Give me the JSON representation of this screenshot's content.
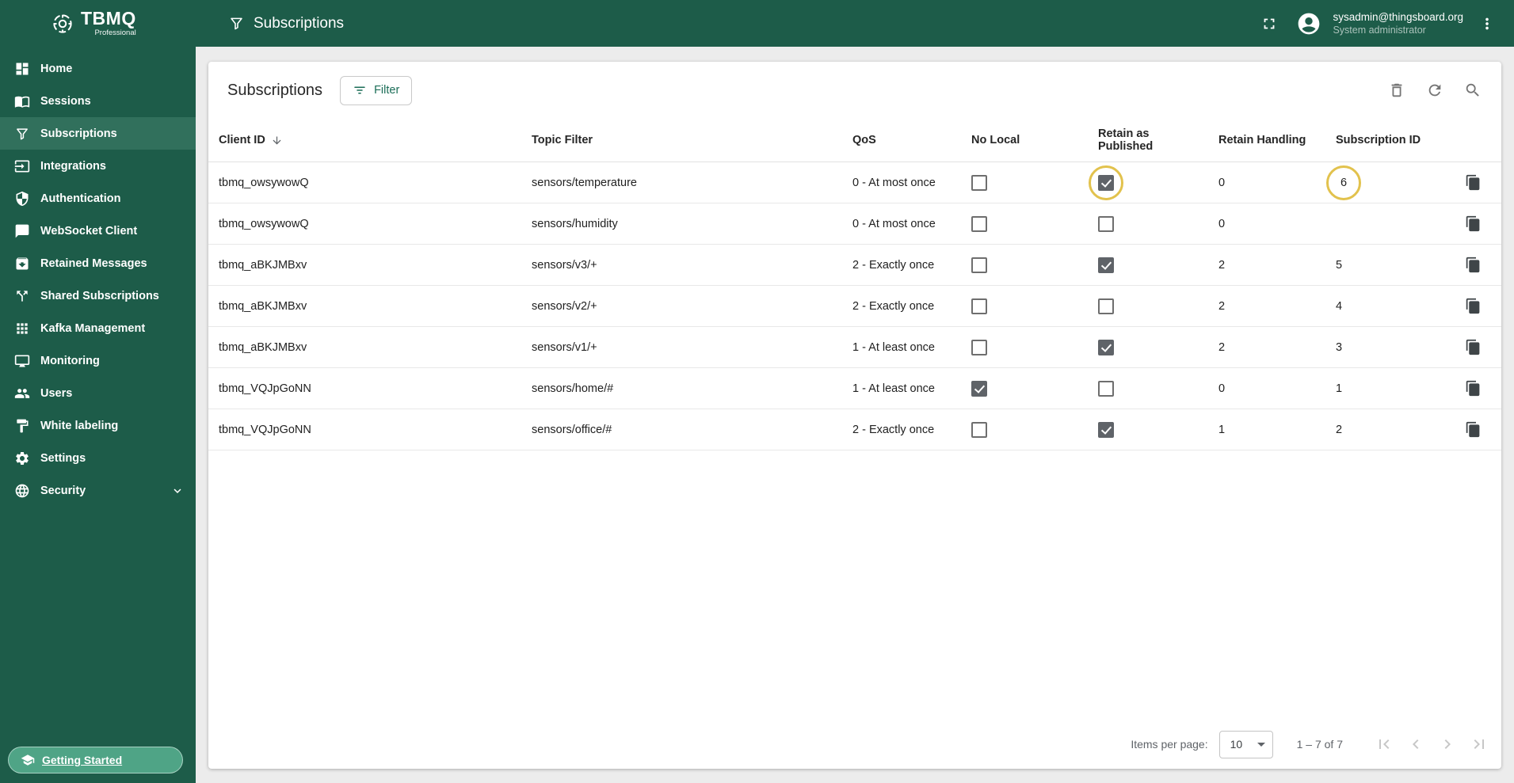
{
  "topbar": {
    "logo_title": "TBMQ",
    "logo_subtitle": "Professional",
    "page_title": "Subscriptions",
    "user": {
      "email": "sysadmin@thingsboard.org",
      "role": "System administrator"
    }
  },
  "sidebar": {
    "items": [
      {
        "label": "Home",
        "icon": "home-icon",
        "active": false
      },
      {
        "label": "Sessions",
        "icon": "sessions-icon",
        "active": false
      },
      {
        "label": "Subscriptions",
        "icon": "subscriptions-funnel-icon",
        "active": true
      },
      {
        "label": "Integrations",
        "icon": "integrations-icon",
        "active": false
      },
      {
        "label": "Authentication",
        "icon": "authentication-shield-icon",
        "active": false
      },
      {
        "label": "WebSocket Client",
        "icon": "websocket-chat-icon",
        "active": false
      },
      {
        "label": "Retained Messages",
        "icon": "retained-messages-archive-icon",
        "active": false
      },
      {
        "label": "Shared Subscriptions",
        "icon": "shared-subscriptions-split-icon",
        "active": false
      },
      {
        "label": "Kafka Management",
        "icon": "kafka-apps-icon",
        "active": false
      },
      {
        "label": "Monitoring",
        "icon": "monitoring-icon",
        "active": false
      },
      {
        "label": "Users",
        "icon": "users-icon",
        "active": false
      },
      {
        "label": "White labeling",
        "icon": "white-labeling-paint-icon",
        "active": false
      },
      {
        "label": "Settings",
        "icon": "settings-gear-icon",
        "active": false
      },
      {
        "label": "Security",
        "icon": "security-globe-icon",
        "active": false,
        "expandable": true
      }
    ],
    "getting_started_label": "Getting Started"
  },
  "card": {
    "title": "Subscriptions",
    "filter_button_label": "Filter"
  },
  "table": {
    "columns": {
      "client_id": "Client ID",
      "topic_filter": "Topic Filter",
      "qos": "QoS",
      "no_local": "No Local",
      "retain_as_published": "Retain as Published",
      "retain_handling": "Retain Handling",
      "subscription_id": "Subscription ID"
    },
    "sort": {
      "column": "client_id",
      "direction": "desc"
    },
    "rows": [
      {
        "client_id": "tbmq_owsywowQ",
        "topic_filter": "sensors/temperature",
        "qos": "0 - At most once",
        "no_local": false,
        "retain_as_published": true,
        "retain_handling": "0",
        "subscription_id": "6",
        "highlight": {
          "retain_as_published": true,
          "subscription_id": true
        }
      },
      {
        "client_id": "tbmq_owsywowQ",
        "topic_filter": "sensors/humidity",
        "qos": "0 - At most once",
        "no_local": false,
        "retain_as_published": false,
        "retain_handling": "0",
        "subscription_id": ""
      },
      {
        "client_id": "tbmq_aBKJMBxv",
        "topic_filter": "sensors/v3/+",
        "qos": "2 - Exactly once",
        "no_local": false,
        "retain_as_published": true,
        "retain_handling": "2",
        "subscription_id": "5"
      },
      {
        "client_id": "tbmq_aBKJMBxv",
        "topic_filter": "sensors/v2/+",
        "qos": "2 - Exactly once",
        "no_local": false,
        "retain_as_published": false,
        "retain_handling": "2",
        "subscription_id": "4"
      },
      {
        "client_id": "tbmq_aBKJMBxv",
        "topic_filter": "sensors/v1/+",
        "qos": "1 - At least once",
        "no_local": false,
        "retain_as_published": true,
        "retain_handling": "2",
        "subscription_id": "3"
      },
      {
        "client_id": "tbmq_VQJpGoNN",
        "topic_filter": "sensors/home/#",
        "qos": "1 - At least once",
        "no_local": true,
        "retain_as_published": false,
        "retain_handling": "0",
        "subscription_id": "1"
      },
      {
        "client_id": "tbmq_VQJpGoNN",
        "topic_filter": "sensors/office/#",
        "qos": "2 - Exactly once",
        "no_local": false,
        "retain_as_published": true,
        "retain_handling": "1",
        "subscription_id": "2"
      }
    ]
  },
  "paginator": {
    "items_per_page_label": "Items per page:",
    "page_size": "10",
    "range_label": "1 – 7 of 7"
  },
  "colors": {
    "primary_green": "#1d5c49",
    "active_item_bg": "#31705c",
    "getting_started_bg": "#4fa486",
    "accent_teal": "#1b6d57",
    "highlight_ring": "#e2c24d",
    "checkbox_checked": "#5f6368"
  }
}
